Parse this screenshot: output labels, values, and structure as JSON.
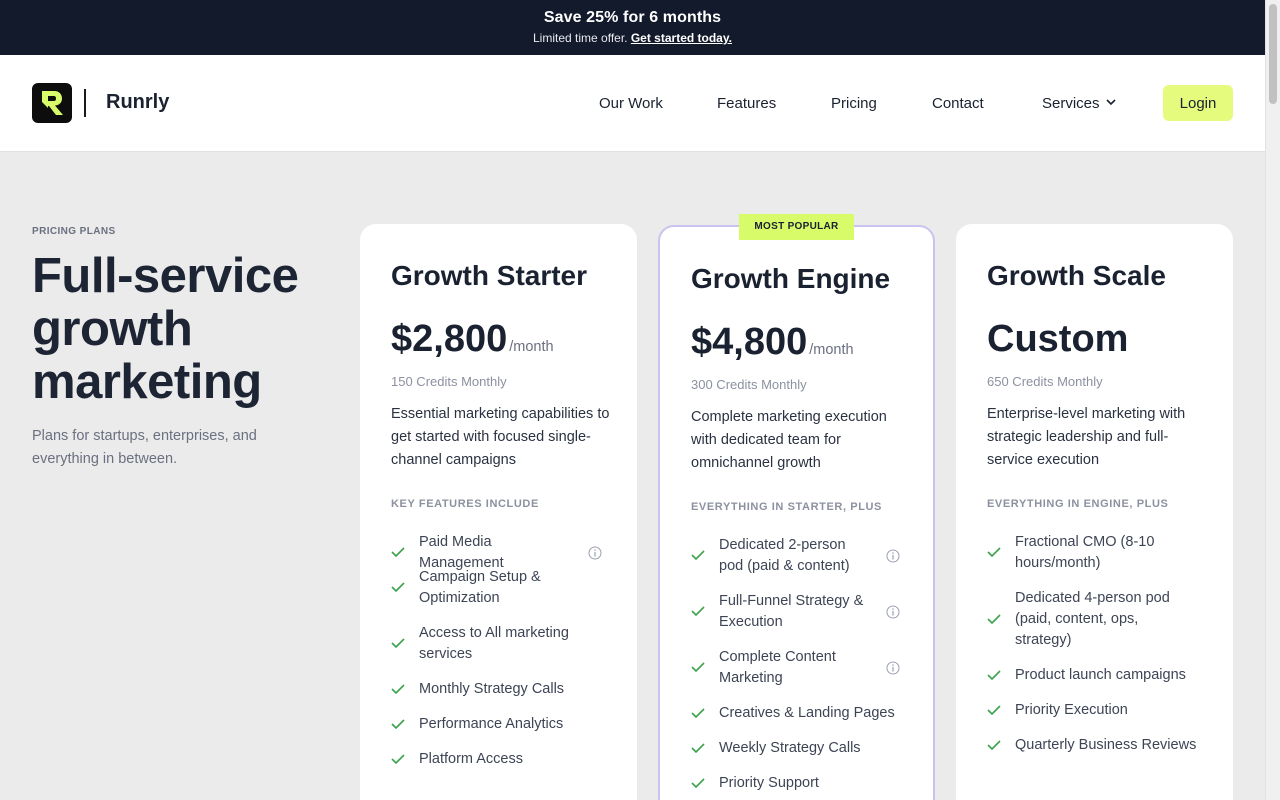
{
  "promo": {
    "title": "Save 25% for 6 months",
    "sub": "Limited time offer.",
    "link": "Get started today."
  },
  "header": {
    "brand": "Runrly",
    "nav": [
      "Our Work",
      "Features",
      "Pricing",
      "Contact",
      "Services"
    ],
    "login": "Login"
  },
  "hero": {
    "eyebrow": "PRICING PLANS",
    "line1": "Full-service",
    "line2": "growth",
    "line3": "marketing",
    "sub": "Plans for startups, enterprises, and everything in between."
  },
  "badge": "MOST POPULAR",
  "plans": [
    {
      "name": "Growth Starter",
      "price": "$2,800",
      "per": "/month",
      "credits": "150 Credits Monthly",
      "desc": "Essential marketing capabilities to get started with focused single-channel campaigns",
      "label": "KEY FEATURES INCLUDE",
      "features": [
        "Paid Media Management",
        "Campaign Setup & Optimization",
        "Access to All marketing services",
        "Monthly Strategy Calls",
        "Performance Analytics",
        "Platform Access"
      ]
    },
    {
      "name": "Growth Engine",
      "price": "$4,800",
      "per": "/month",
      "credits": "300 Credits Monthly",
      "desc": "Complete marketing execution with dedicated team for omnichannel growth",
      "label": "EVERYTHING IN STARTER, PLUS",
      "features": [
        "Dedicated 2-person pod (paid & content)",
        "Full-Funnel Strategy & Execution",
        "Complete Content Marketing",
        "Creatives & Landing Pages",
        "Weekly Strategy Calls",
        "Priority Support"
      ]
    },
    {
      "name": "Growth Scale",
      "price": "Custom",
      "per": "",
      "credits": "650 Credits Monthly",
      "desc": "Enterprise-level marketing with strategic leadership and full-service execution",
      "label": "EVERYTHING IN ENGINE, PLUS",
      "features": [
        "Fractional CMO (8-10 hours/month)",
        "Dedicated 4-person pod (paid, content, ops, strategy)",
        "Product launch campaigns",
        "Priority Execution",
        "Quarterly Business Reviews"
      ]
    }
  ],
  "colors": {
    "accent": "#e4fb7d",
    "badge": "#d8fb6a",
    "check": "#3aa24b",
    "dark": "#131a2c",
    "featured_border": "#c9c4ef"
  }
}
